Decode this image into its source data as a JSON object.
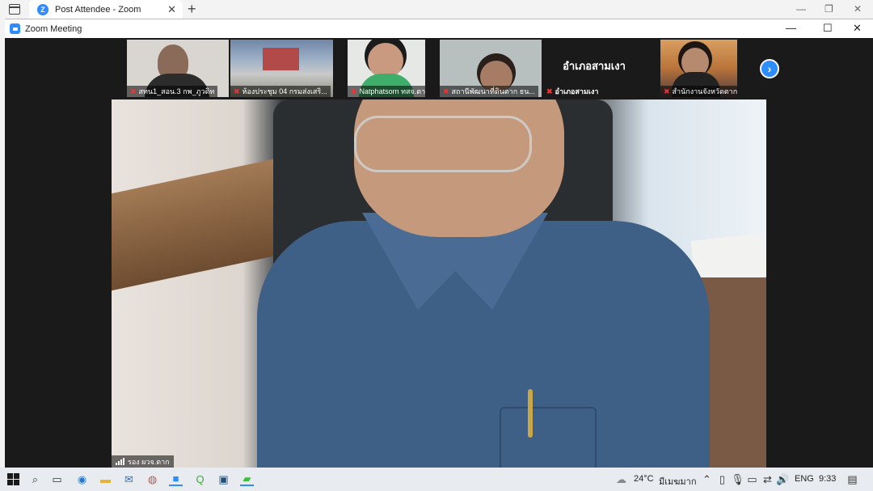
{
  "browser": {
    "tab_title": "Post Attendee - Zoom",
    "tab_close": "✕",
    "new_tab": "+",
    "min": "—",
    "restore": "❐",
    "close": "✕"
  },
  "zoom_window": {
    "title": "Zoom Meeting",
    "min": "—",
    "max": "☐",
    "close": "✕"
  },
  "participants": [
    {
      "name": "สทน1_สอน.3 กพ_ภูวดิท",
      "mic_muted": true,
      "bg": "#d9d6d2"
    },
    {
      "name": "ห้องประชุม 04 กรมส่งเสริ...",
      "mic_muted": true,
      "bg": "#7f8fa8"
    },
    {
      "name": "Natphatsorn ทสจ.ตาก",
      "mic_muted": true,
      "bg": "#e6e8e6"
    },
    {
      "name": "สถานีพัฒนาที่ดินตาก ธน...",
      "mic_muted": true,
      "bg": "#b8bfbf"
    },
    {
      "name": "อำเภอสามเงา",
      "display_name": "อำเภอสามเงา",
      "mic_muted": true,
      "bg": "#1a1a1a"
    },
    {
      "name": "สำนักงานจังหวัดตาก",
      "mic_muted": true,
      "bg": "#b9743a"
    }
  ],
  "next_page_icon": "›",
  "main_speaker": {
    "name": "รอง ผวจ.ตาก"
  },
  "taskbar": {
    "weather": "24°C",
    "weather_desc": "มีเมฆมาก",
    "language": "ENG",
    "time": "9:33"
  }
}
